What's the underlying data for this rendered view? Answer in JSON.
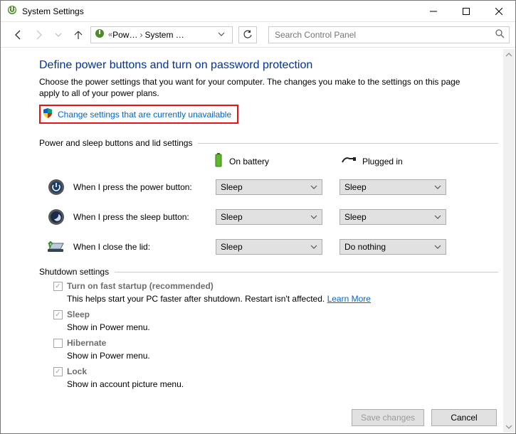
{
  "window": {
    "title": "System Settings"
  },
  "nav": {
    "crumb_prev": "Pow…",
    "crumb_current": "System …",
    "search_placeholder": "Search Control Panel"
  },
  "main": {
    "heading": "Define power buttons and turn on password protection",
    "description": "Choose the power settings that you want for your computer. The changes you make to the settings on this page apply to all of your power plans.",
    "elev_link": "Change settings that are currently unavailable"
  },
  "buttons_section": {
    "label": "Power and sleep buttons and lid settings",
    "col_battery": "On battery",
    "col_plugged": "Plugged in",
    "rows": [
      {
        "label": "When I press the power button:",
        "battery": "Sleep",
        "plugged": "Sleep"
      },
      {
        "label": "When I press the sleep button:",
        "battery": "Sleep",
        "plugged": "Sleep"
      },
      {
        "label": "When I close the lid:",
        "battery": "Sleep",
        "plugged": "Do nothing"
      }
    ]
  },
  "shutdown_section": {
    "label": "Shutdown settings",
    "items": [
      {
        "title": "Turn on fast startup (recommended)",
        "desc": "This helps start your PC faster after shutdown. Restart isn't affected. ",
        "link": "Learn More",
        "checked": true
      },
      {
        "title": "Sleep",
        "desc": "Show in Power menu.",
        "checked": true
      },
      {
        "title": "Hibernate",
        "desc": "Show in Power menu.",
        "checked": false
      },
      {
        "title": "Lock",
        "desc": "Show in account picture menu.",
        "checked": true
      }
    ]
  },
  "footer": {
    "save": "Save changes",
    "cancel": "Cancel"
  }
}
